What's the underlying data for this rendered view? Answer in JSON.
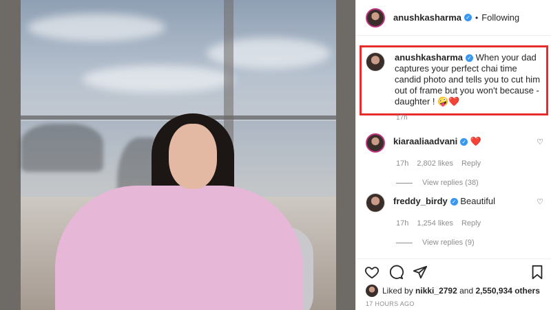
{
  "post": {
    "author": "anushkasharma",
    "follow_status": "Following",
    "separator": "•",
    "caption_text": "When your dad captures your perfect chai time candid photo and tells you to cut him out of frame but you won't because - daughter ! 🤪❤️",
    "caption_time": "17h"
  },
  "comments": [
    {
      "user": "kiaraaliaadvani",
      "text": "❤️",
      "time": "17h",
      "likes": "2,802 likes",
      "reply_label": "Reply",
      "view_replies": "View replies (38)"
    },
    {
      "user": "freddy_birdy",
      "text": "Beautiful",
      "time": "17h",
      "likes": "1,254 likes",
      "reply_label": "Reply",
      "view_replies": "View replies (9)"
    }
  ],
  "likes_summary": {
    "prefix": "Liked by",
    "first_user": "nikki_2792",
    "connector": "and",
    "others": "2,550,934 others"
  },
  "posted_time": "17 HOURS AGO",
  "colors": {
    "highlight": "#e52b2b",
    "verified": "#3897f0",
    "heart": "#ed4956"
  },
  "icons": {
    "like": "heart-icon",
    "comment": "comment-icon",
    "share": "share-icon",
    "save": "bookmark-icon"
  }
}
